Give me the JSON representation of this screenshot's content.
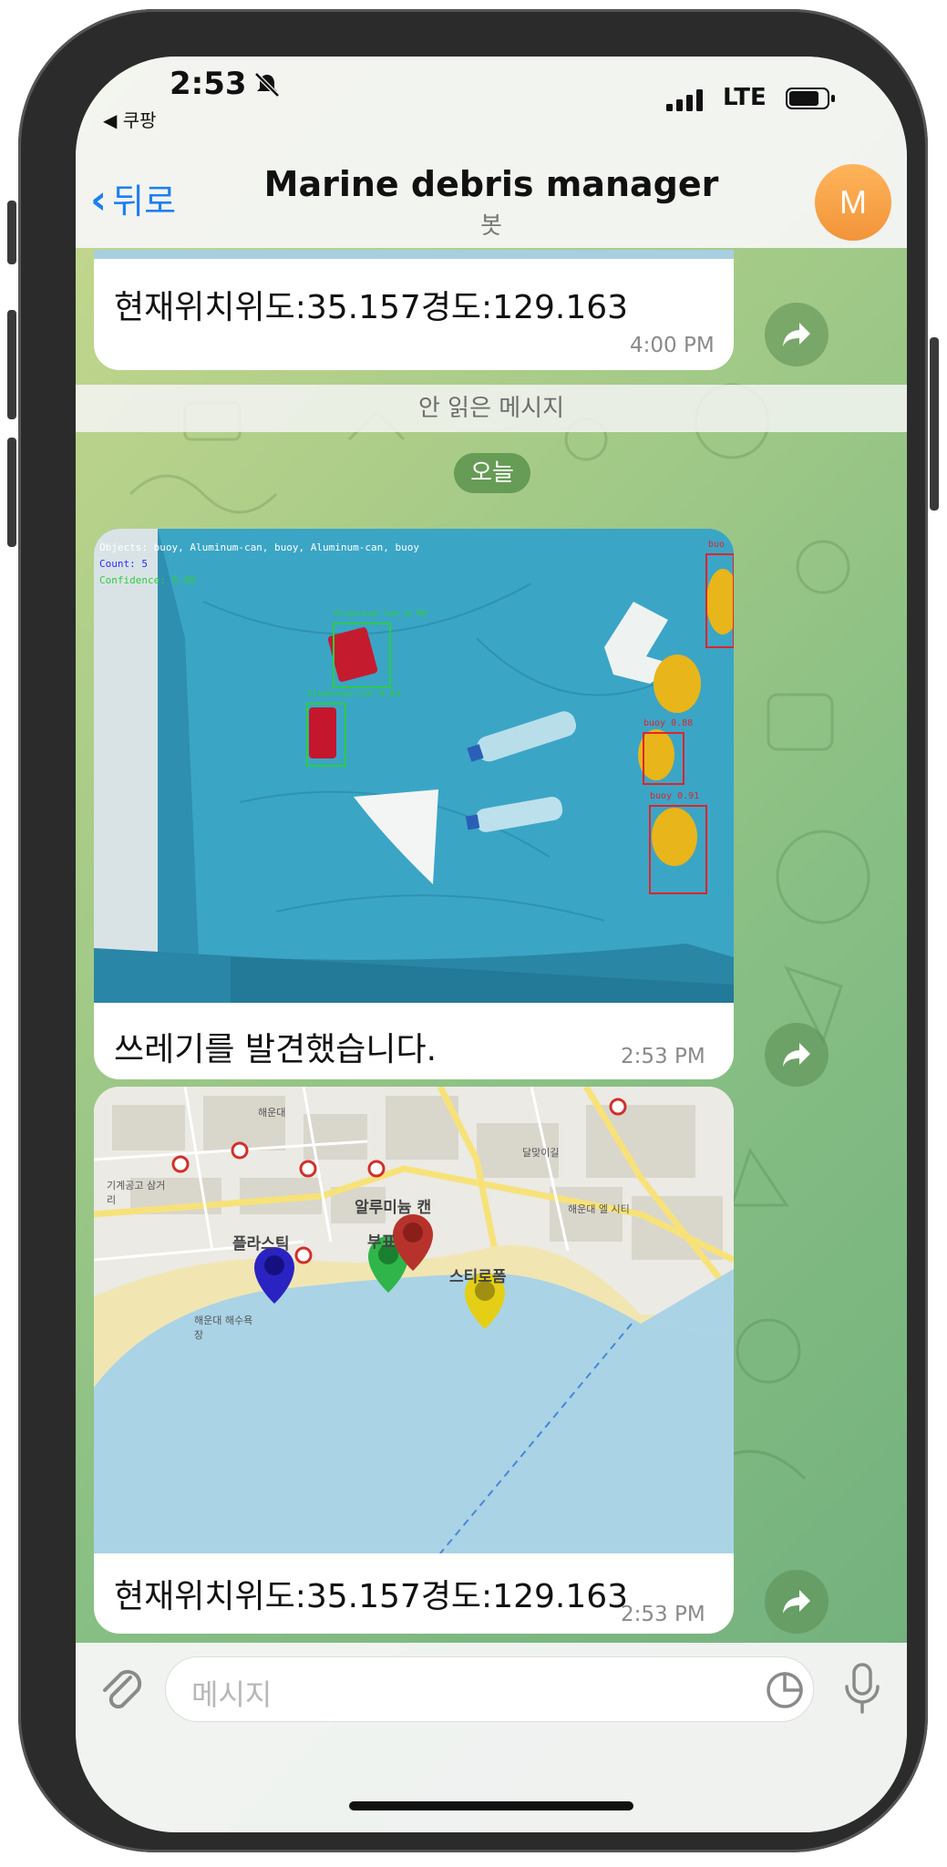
{
  "status_bar": {
    "time": "2:53",
    "back_app": "◀ 쿠팡",
    "network": "LTE"
  },
  "header": {
    "back_label": "뒤로",
    "title": "Marine debris manager",
    "subtitle": "봇",
    "avatar_initial": "M"
  },
  "messages": [
    {
      "text": "현재위치위도:35.157경도:129.163",
      "time": "4:00 PM"
    },
    {
      "image_caption": "쓰레기를 발견했습니다.",
      "time": "2:53 PM",
      "detection_overlay": {
        "objects": "Objects: buoy, Aluminum-can, buoy, Aluminum-can, buoy",
        "count": "Count: 5",
        "confidence": "Confidence: 0.86",
        "boxes": [
          {
            "label": "Aluminum-can 0.90",
            "color": "#2ecc40"
          },
          {
            "label": "Aluminum-can 0.83",
            "color": "#2ecc40"
          },
          {
            "label": "buoy 0.88",
            "color": "#e0242a"
          },
          {
            "label": "buoy 0.91",
            "color": "#e0242a"
          },
          {
            "label": "buo",
            "color": "#e0242a"
          }
        ]
      }
    },
    {
      "text": "현재위치위도:35.157경도:129.163",
      "time": "2:53 PM",
      "map": {
        "markers": [
          {
            "label": "플라스틱",
            "color": "#2a23c2"
          },
          {
            "label": "알루미늄 캔",
            "color": "#2fb54a"
          },
          {
            "label": "부표",
            "color": "#b8322c"
          },
          {
            "label": "스티로폼",
            "color": "#e4cf16"
          }
        ],
        "place_labels": [
          "해운대",
          "기계공고 삼거리",
          "해운대 해수욕장",
          "해운대 엘 시티",
          "달맞이길"
        ]
      }
    }
  ],
  "unread_divider": "안 읽은 메시지",
  "date_pill": "오늘",
  "composer": {
    "placeholder": "메시지"
  },
  "colors": {
    "accent_blue": "#1e7ff0",
    "chat_bg": "#a9cc88",
    "avatar": "#f5a04a"
  }
}
